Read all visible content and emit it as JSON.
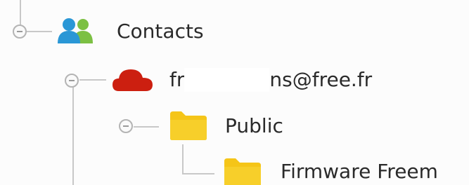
{
  "tree": {
    "root": {
      "label": "Contacts",
      "icon": "contacts-icon",
      "expanded": true
    },
    "account": {
      "label_prefix": "fr",
      "label_suffix": "ns@free.fr",
      "icon": "cloud-icon",
      "icon_color": "#cc1f10",
      "expanded": true
    },
    "folder_public": {
      "label": "Public",
      "icon": "folder-icon",
      "expanded": true
    },
    "folder_firmware": {
      "label": "Firmware Freem",
      "icon": "folder-icon"
    }
  },
  "colors": {
    "folder": "#f5c518",
    "contacts_primary": "#2a97d6",
    "contacts_secondary": "#7cc043"
  }
}
